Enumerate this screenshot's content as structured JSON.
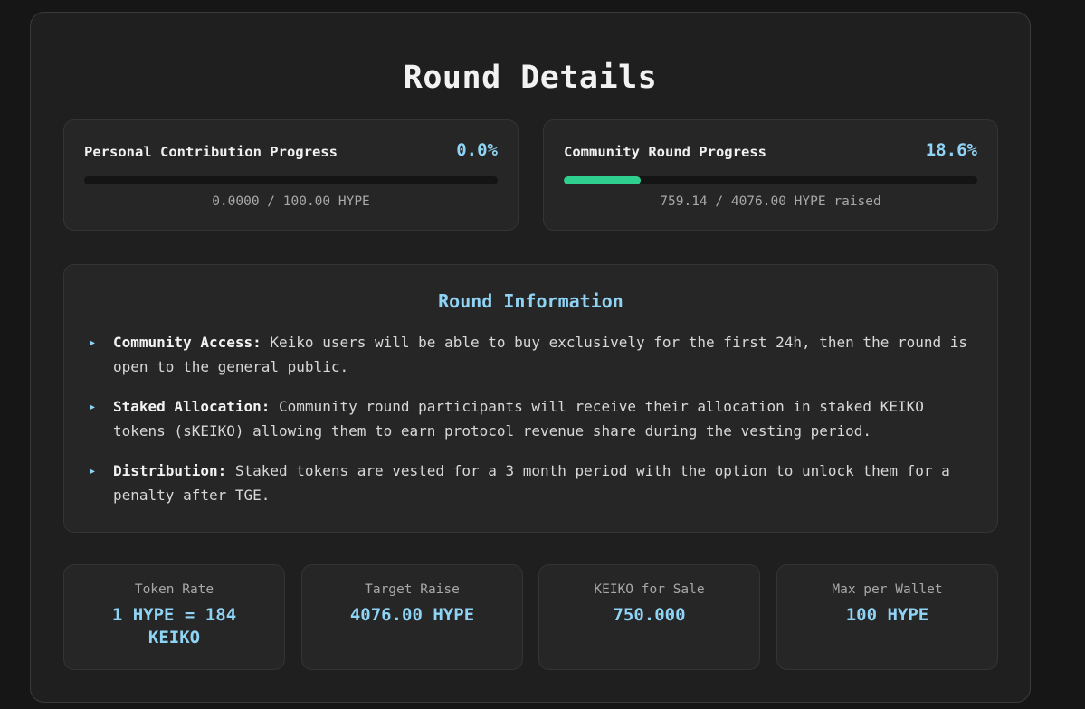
{
  "page": {
    "title": "Round Details"
  },
  "personal": {
    "label": "Personal Contribution Progress",
    "percent_text": "0.0%",
    "progress": 0.0,
    "detail": "0.0000 / 100.00 HYPE"
  },
  "community": {
    "label": "Community Round Progress",
    "percent_text": "18.6%",
    "progress": 0.186,
    "detail": "759.14 / 4076.00 HYPE raised"
  },
  "info": {
    "title": "Round Information",
    "items": [
      {
        "term": "Community Access:",
        "text": " Keiko users will be able to buy exclusively for the first 24h, then the round is open to the general public."
      },
      {
        "term": "Staked Allocation:",
        "text": " Community round participants will receive their allocation in staked KEIKO tokens (sKEIKO) allowing them to earn protocol revenue share during the vesting period."
      },
      {
        "term": "Distribution:",
        "text": " Staked tokens are vested for a 3 month period with the option to unlock them for a penalty after TGE."
      }
    ]
  },
  "stats": [
    {
      "label": "Token Rate",
      "value": "1 HYPE = 184 KEIKO"
    },
    {
      "label": "Target Raise",
      "value": "4076.00 HYPE"
    },
    {
      "label": "KEIKO for Sale",
      "value": "750.000"
    },
    {
      "label": "Max per Wallet",
      "value": "100 HYPE"
    }
  ],
  "colors": {
    "accent": "#8fd3f5",
    "progress_fill": "#2fcf8f",
    "background": "#161616",
    "panel": "#1f1f1f",
    "card": "#262626"
  },
  "icons": {
    "bullet": "triangle-right-icon"
  }
}
